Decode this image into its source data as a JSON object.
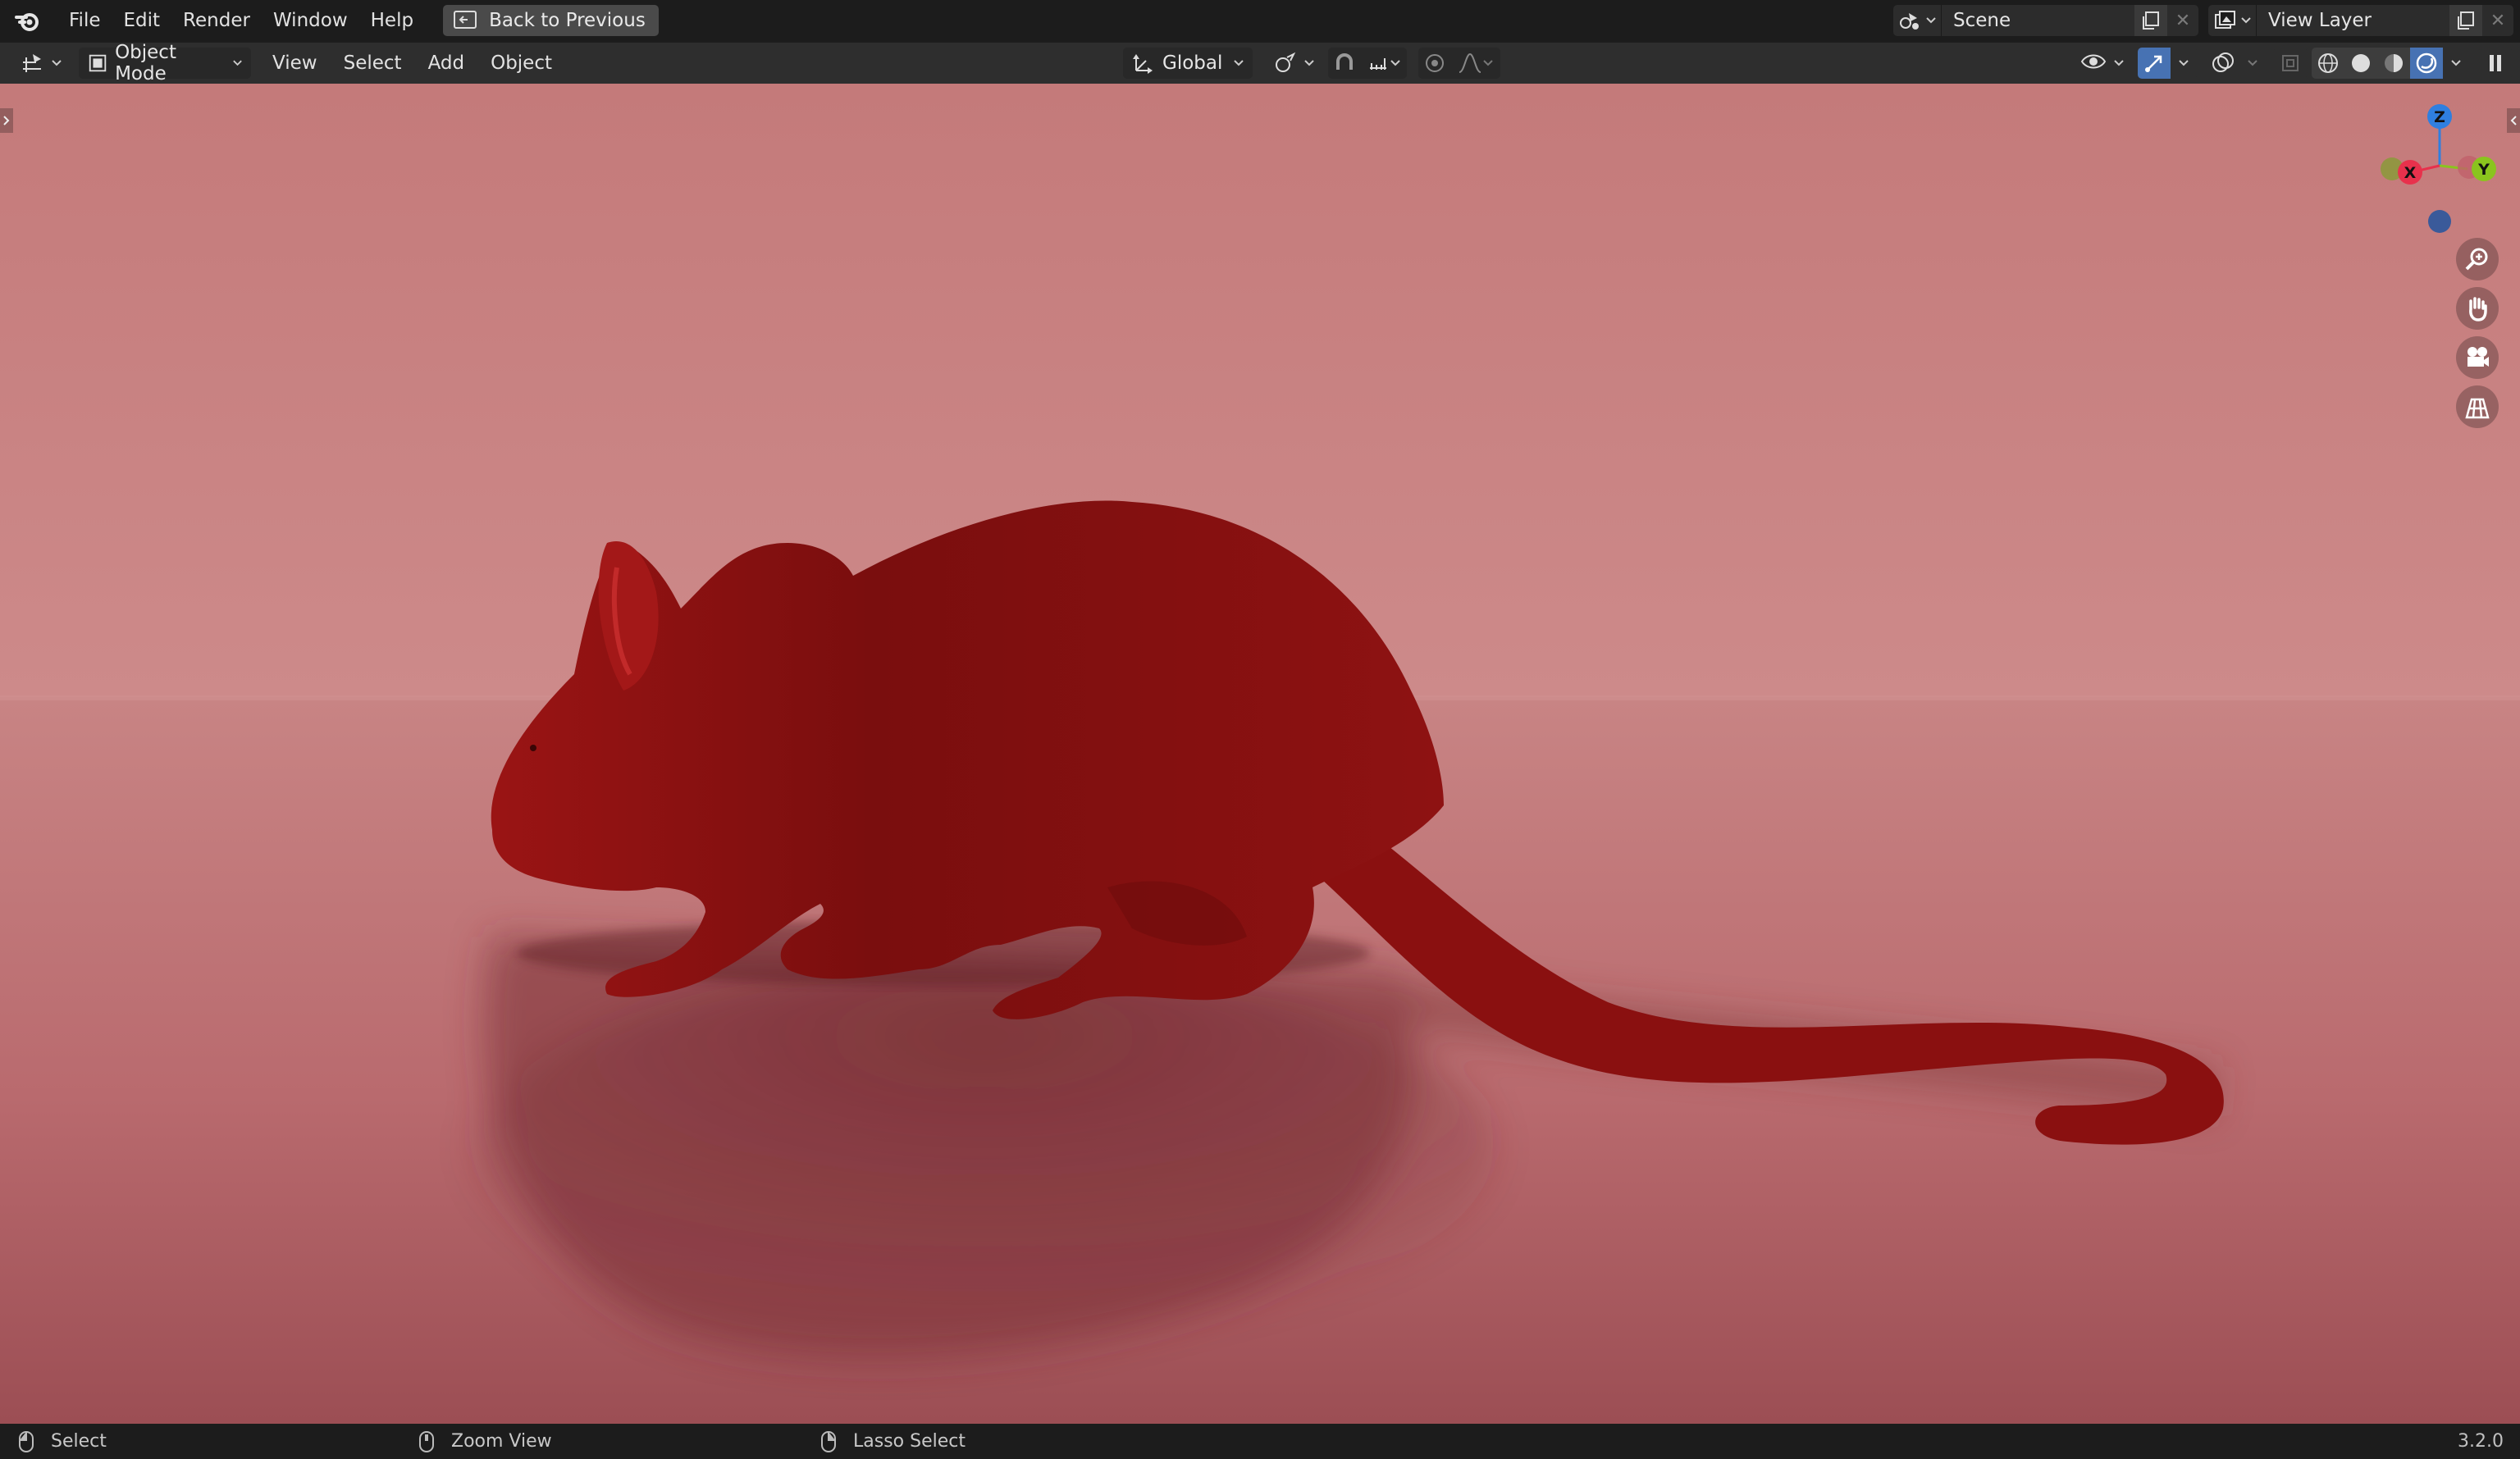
{
  "topbar": {
    "menu": [
      "File",
      "Edit",
      "Render",
      "Window",
      "Help"
    ],
    "back_button": "Back to Previous",
    "scene_name": "Scene",
    "view_layer_name": "View Layer"
  },
  "header": {
    "mode": "Object Mode",
    "menus": [
      "View",
      "Select",
      "Add",
      "Object"
    ],
    "transform_orientation": "Global"
  },
  "viewport": {
    "gizmo_axes": {
      "x": "X",
      "y": "Y",
      "z": "Z"
    },
    "axis_colors": {
      "x": "#e8314c",
      "y": "#8ac41e",
      "z": "#2f7fe0"
    },
    "background_color": "#c47e7e",
    "subject": "red rat model"
  },
  "statusbar": {
    "items": [
      "Select",
      "Zoom View",
      "Lasso Select"
    ],
    "version": "3.2.0"
  },
  "icons": {
    "logo": "blender-logo-icon",
    "back": "back-to-previous-icon",
    "scene": "scene-icon",
    "view_layer": "view-layer-icon",
    "editor_type": "editor-type-icon",
    "mode": "object-mode-icon",
    "orientation": "transform-orientation-icon",
    "pivot": "pivot-point-icon",
    "snap": "snap-icon",
    "proportional": "proportional-editing-icon",
    "visibility": "object-visibility-icon",
    "gizmo": "gizmo-icon",
    "overlay": "overlay-icon",
    "xray": "xray-icon",
    "shading_wire": "wireframe-shading-icon",
    "shading_solid": "solid-shading-icon",
    "shading_material": "material-preview-icon",
    "shading_render": "rendered-shading-icon",
    "zoom": "zoom-icon",
    "pan": "pan-hand-icon",
    "camera": "camera-view-icon",
    "ortho": "orthographic-grid-icon",
    "mouse": "mouse-icon"
  }
}
